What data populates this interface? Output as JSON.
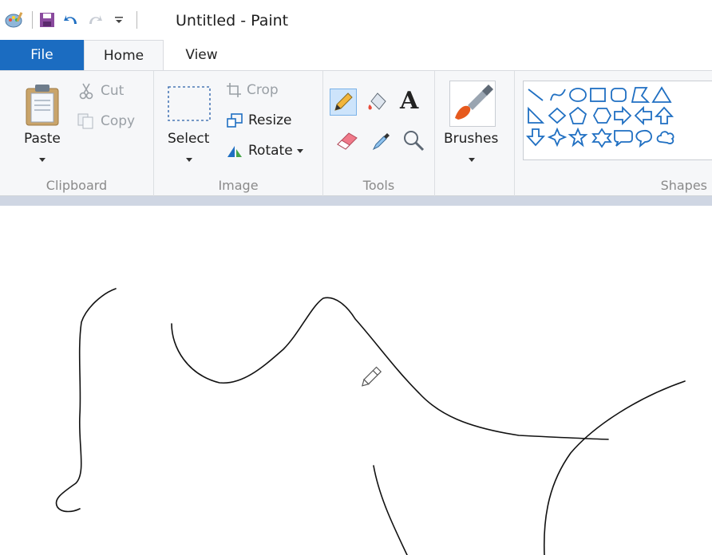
{
  "window": {
    "title": "Untitled - Paint"
  },
  "tabs": {
    "file": "File",
    "home": "Home",
    "view": "View"
  },
  "clipboard": {
    "paste": "Paste",
    "cut": "Cut",
    "copy": "Copy",
    "group_label": "Clipboard"
  },
  "image": {
    "select": "Select",
    "crop": "Crop",
    "resize": "Resize",
    "rotate": "Rotate",
    "group_label": "Image"
  },
  "tools": {
    "group_label": "Tools",
    "text_glyph": "A"
  },
  "brushes": {
    "label": "Brushes"
  },
  "shapes": {
    "group_label": "Shapes"
  },
  "colors": {
    "accent": "#1b6cc1",
    "ribbon_bg": "#f6f7f9",
    "stroke": "#111111"
  }
}
